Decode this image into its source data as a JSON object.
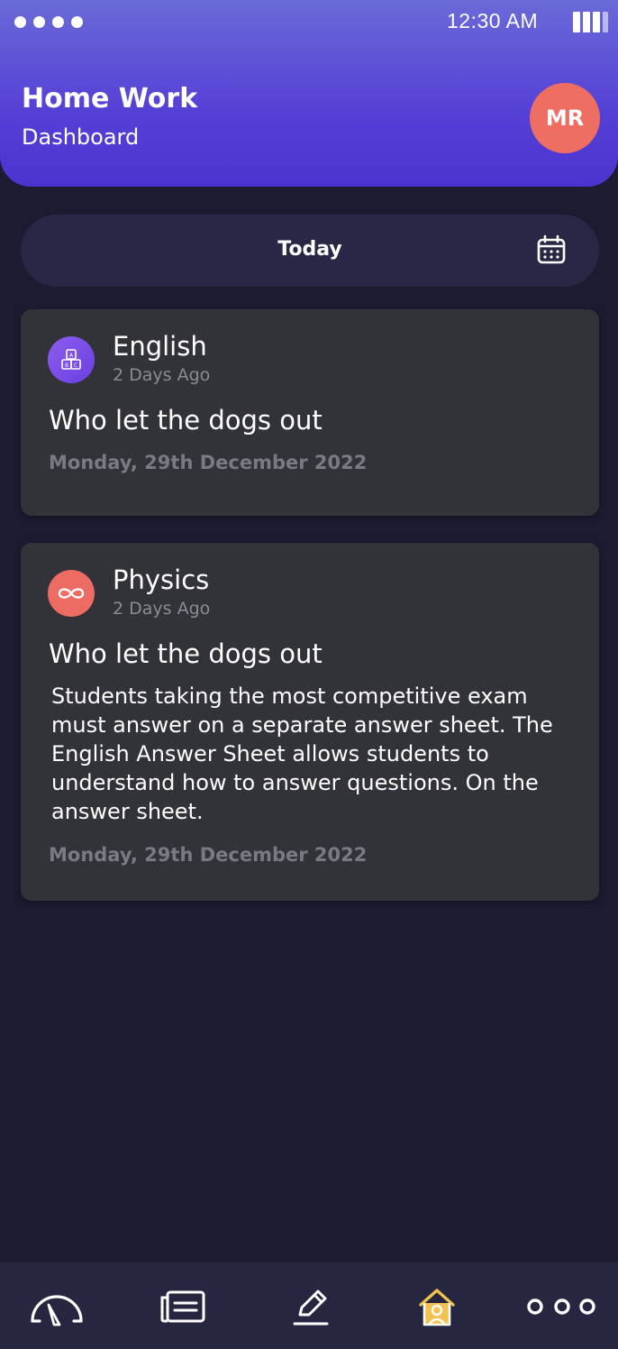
{
  "status_bar": {
    "time": "12:30 AM"
  },
  "header": {
    "title": "Home Work",
    "subtitle": "Dashboard",
    "avatar_initials": "MR"
  },
  "date_filter": {
    "label": "Today"
  },
  "cards": [
    {
      "subject": "English",
      "ago": "2 Days Ago",
      "title": "Who let the dogs out",
      "description": "",
      "date": "Monday, 29th December 2022",
      "icon": "abc-blocks-icon",
      "icon_color": "#7b4ee8"
    },
    {
      "subject": "Physics",
      "ago": "2 Days Ago",
      "title": "Who let the dogs out",
      "description": "Students taking the most competitive exam must answer on a separate answer sheet. The English Answer Sheet allows students to understand how to answer questions. On the answer sheet.",
      "date": "Monday, 29th December 2022",
      "icon": "infinity-icon",
      "icon_color": "#ec6b63"
    }
  ],
  "nav": {
    "items": [
      "dashboard-icon",
      "list-icon",
      "edit-icon",
      "home-icon",
      "more-icon"
    ],
    "active": "home-icon",
    "active_color": "#f2c14e"
  },
  "colors": {
    "background": "#1c1b31",
    "header_gradient_start": "#6a6ad8",
    "header_gradient_end": "#4a34cf",
    "card": "#323239",
    "avatar": "#ee6e62"
  }
}
